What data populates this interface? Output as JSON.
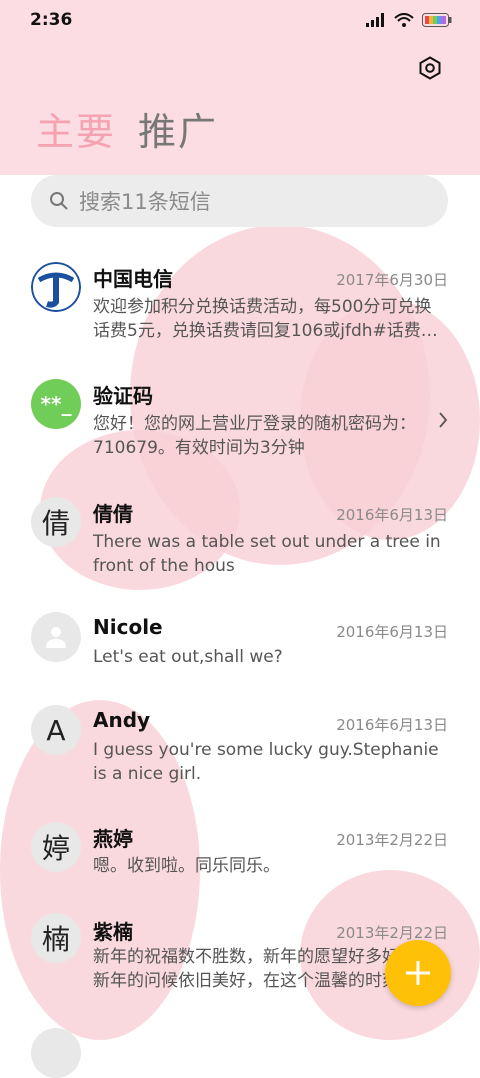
{
  "status_bar": {
    "time": "2:36"
  },
  "tabs": [
    {
      "label": "主要",
      "active": true
    },
    {
      "label": "推广",
      "active": false
    }
  ],
  "search": {
    "placeholder": "搜索11条短信"
  },
  "conversations": [
    {
      "name": "中国电信",
      "date": "2017年6月30日",
      "preview": "欢迎参加积分兑换话费活动，每500分可兑换话费5元，兑换话费请回复106或jfdh#话费…",
      "avatar": "logo-icon"
    },
    {
      "name": "验证码",
      "date": "",
      "preview": "您好！您的网上营业厅登录的随机密码为：710679。有效时间为3分钟",
      "avatar_text": "**_"
    },
    {
      "name": "倩倩",
      "date": "2016年6月13日",
      "preview": "There was a table set out under a tree in front of the hous",
      "avatar_text": "倩"
    },
    {
      "name": "Nicole",
      "date": "2016年6月13日",
      "preview": "Let's eat out,shall we?",
      "avatar": "person-icon"
    },
    {
      "name": "Andy",
      "date": "2016年6月13日",
      "preview": "I guess you're some lucky guy.Stephanie is a nice girl.",
      "avatar_text": "A"
    },
    {
      "name": "燕婷",
      "date": "2013年2月22日",
      "preview": "嗯。收到啦。同乐同乐。",
      "avatar_text": "婷"
    },
    {
      "name": "紫楠",
      "date": "2013年2月22日",
      "preview": "新年的祝福数不胜数，新年的愿望好多好多，新年的问候依旧美好，在这个温馨的时刻",
      "avatar_text": "楠"
    }
  ],
  "colors": {
    "header_bg": "#fbdde3",
    "active_tab": "#f5a3b0",
    "fab": "#ffc107",
    "green_avatar": "#6fcd58"
  }
}
